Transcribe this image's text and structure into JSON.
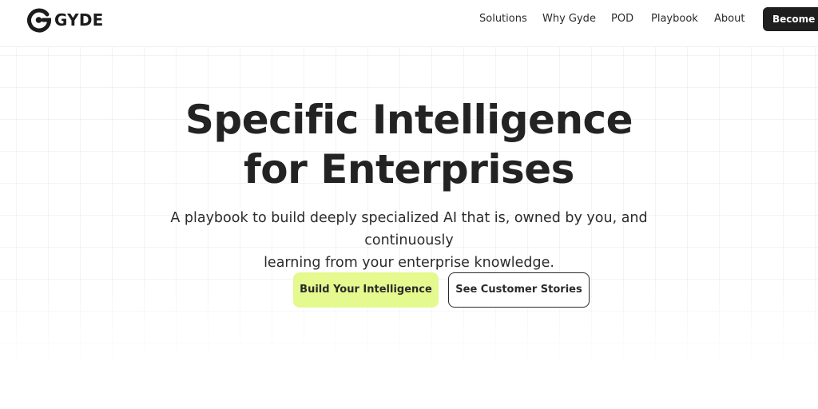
{
  "brand": {
    "name": "GYDE",
    "logo_icon": "gyde-logo-icon"
  },
  "nav": {
    "items": [
      {
        "label": "Solutions"
      },
      {
        "label": "Why Gyde"
      },
      {
        "label": "POD"
      },
      {
        "label": "Playbook"
      },
      {
        "label": "About"
      }
    ],
    "cta_label": "Become AI"
  },
  "hero": {
    "headline_line1": "Specific Intelligence",
    "headline_line2": "for Enterprises",
    "subtitle_line1": "A playbook to build deeply specialized AI that is, owned by you, and continuously",
    "subtitle_line2": "learning from your enterprise knowledge.",
    "primary_button": "Build Your Intelligence",
    "secondary_button": "See Customer Stories"
  },
  "colors": {
    "accent": "#e4f98e",
    "dark": "#1f1f1f",
    "background": "#ffffff"
  }
}
